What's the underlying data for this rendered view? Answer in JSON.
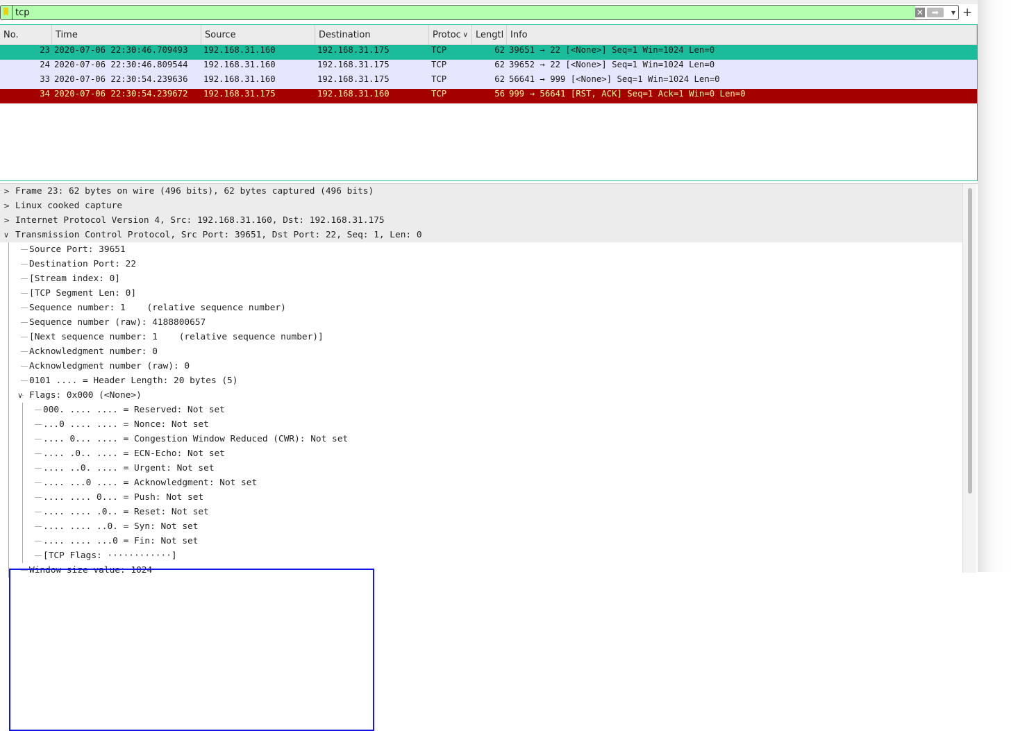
{
  "filter": {
    "value": "tcp",
    "clear_icon": "clear-icon",
    "apply_icon": "arrow-right-icon",
    "dropdown_icon": "chevron-down-icon",
    "add_label": "+"
  },
  "packet_list": {
    "columns": [
      "No.",
      "Time",
      "Source",
      "Destination",
      "Protocol",
      "Length",
      "Info"
    ],
    "column_display": [
      "No.",
      "Time",
      "Source",
      "Destination",
      "Protoc",
      "Lengtl",
      "Info"
    ],
    "rows": [
      {
        "no": "23",
        "time": "2020-07-06 22:30:46.709493",
        "src": "192.168.31.160",
        "dst": "192.168.31.175",
        "proto": "TCP",
        "len": "62",
        "info": "39651 → 22 [<None>] Seq=1 Win=1024 Len=0",
        "bg": "#1abc9c",
        "fg": "#1a1a1a",
        "selected": true
      },
      {
        "no": "24",
        "time": "2020-07-06 22:30:46.809544",
        "src": "192.168.31.160",
        "dst": "192.168.31.175",
        "proto": "TCP",
        "len": "62",
        "info": "39652 → 22 [<None>] Seq=1 Win=1024 Len=0",
        "bg": "#e6e6fe",
        "fg": "#1a1a1a"
      },
      {
        "no": "33",
        "time": "2020-07-06 22:30:54.239636",
        "src": "192.168.31.160",
        "dst": "192.168.31.175",
        "proto": "TCP",
        "len": "62",
        "info": "56641 → 999 [<None>] Seq=1 Win=1024 Len=0",
        "bg": "#e6e6fe",
        "fg": "#1a1a1a"
      },
      {
        "no": "34",
        "time": "2020-07-06 22:30:54.239672",
        "src": "192.168.31.175",
        "dst": "192.168.31.160",
        "proto": "TCP",
        "len": "56",
        "info": "999 → 56641 [RST, ACK] Seq=1 Ack=1 Win=0 Len=0",
        "bg": "#a40000",
        "fg": "#fffc9c"
      }
    ]
  },
  "details": [
    {
      "level": 0,
      "text": "Frame 23: 62 bytes on wire (496 bits), 62 bytes captured (496 bits)",
      "expander": "collapsed"
    },
    {
      "level": 0,
      "text": "Linux cooked capture",
      "expander": "collapsed"
    },
    {
      "level": 0,
      "text": "Internet Protocol Version 4, Src: 192.168.31.160, Dst: 192.168.31.175",
      "expander": "collapsed"
    },
    {
      "level": 0,
      "text": "Transmission Control Protocol, Src Port: 39651, Dst Port: 22, Seq: 1, Len: 0",
      "expander": "expanded"
    },
    {
      "level": 1,
      "text": "Source Port: 39651"
    },
    {
      "level": 1,
      "text": "Destination Port: 22"
    },
    {
      "level": 1,
      "text": "[Stream index: 0]"
    },
    {
      "level": 1,
      "text": "[TCP Segment Len: 0]"
    },
    {
      "level": 1,
      "text": "Sequence number: 1    (relative sequence number)"
    },
    {
      "level": 1,
      "text": "Sequence number (raw): 4188800657"
    },
    {
      "level": 1,
      "text": "[Next sequence number: 1    (relative sequence number)]"
    },
    {
      "level": 1,
      "text": "Acknowledgment number: 0"
    },
    {
      "level": 1,
      "text": "Acknowledgment number (raw): 0"
    },
    {
      "level": 1,
      "text": "0101 .... = Header Length: 20 bytes (5)"
    },
    {
      "level": 1,
      "text": "Flags: 0x000 (<None>)",
      "expander": "expanded"
    },
    {
      "level": 2,
      "text": "000. .... .... = Reserved: Not set"
    },
    {
      "level": 2,
      "text": "...0 .... .... = Nonce: Not set"
    },
    {
      "level": 2,
      "text": ".... 0... .... = Congestion Window Reduced (CWR): Not set"
    },
    {
      "level": 2,
      "text": ".... .0.. .... = ECN-Echo: Not set"
    },
    {
      "level": 2,
      "text": ".... ..0. .... = Urgent: Not set"
    },
    {
      "level": 2,
      "text": ".... ...0 .... = Acknowledgment: Not set"
    },
    {
      "level": 2,
      "text": ".... .... 0... = Push: Not set"
    },
    {
      "level": 2,
      "text": ".... .... .0.. = Reset: Not set"
    },
    {
      "level": 2,
      "text": ".... .... ..0. = Syn: Not set"
    },
    {
      "level": 2,
      "text": ".... .... ...0 = Fin: Not set"
    },
    {
      "level": 2,
      "text": "[TCP Flags: ············]"
    },
    {
      "level": 1,
      "text": "Window size value: 1024"
    }
  ],
  "highlight_color": "#1414e6"
}
